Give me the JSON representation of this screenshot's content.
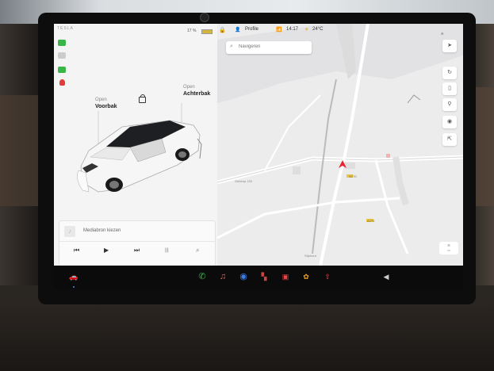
{
  "status": {
    "brand": "TESLA",
    "battery": "17 %"
  },
  "topbar": {
    "profile": "Profile",
    "time": "14:17",
    "temperature": "24°C"
  },
  "car": {
    "front_trunk_state": "Open",
    "front_trunk_label": "Voorbak",
    "rear_trunk_state": "Open",
    "rear_trunk_label": "Achterbak"
  },
  "media": {
    "title": "Mediabron kiezen"
  },
  "search": {
    "placeholder": "Navigeren"
  },
  "map": {
    "place_1": "Geldrop 153",
    "place_2": "Stiphout",
    "road_1": "N270",
    "road_2": "A270"
  },
  "colors": {
    "accent_green": "#39b54a",
    "nav_arrow": "#e8232b",
    "battery": "#d6b53a",
    "screen_bg": "#f2f2f2"
  },
  "icons": {
    "left_status": [
      "headlights-icon",
      "fog-lights-icon",
      "parking-lights-icon",
      "seatbelt-icon"
    ],
    "taskbar": [
      "car-icon",
      "phone-icon",
      "music-icon",
      "camera-icon",
      "energy-icon",
      "calendar-icon",
      "apps-icon",
      "dashcam-icon",
      "volume-icon"
    ]
  }
}
